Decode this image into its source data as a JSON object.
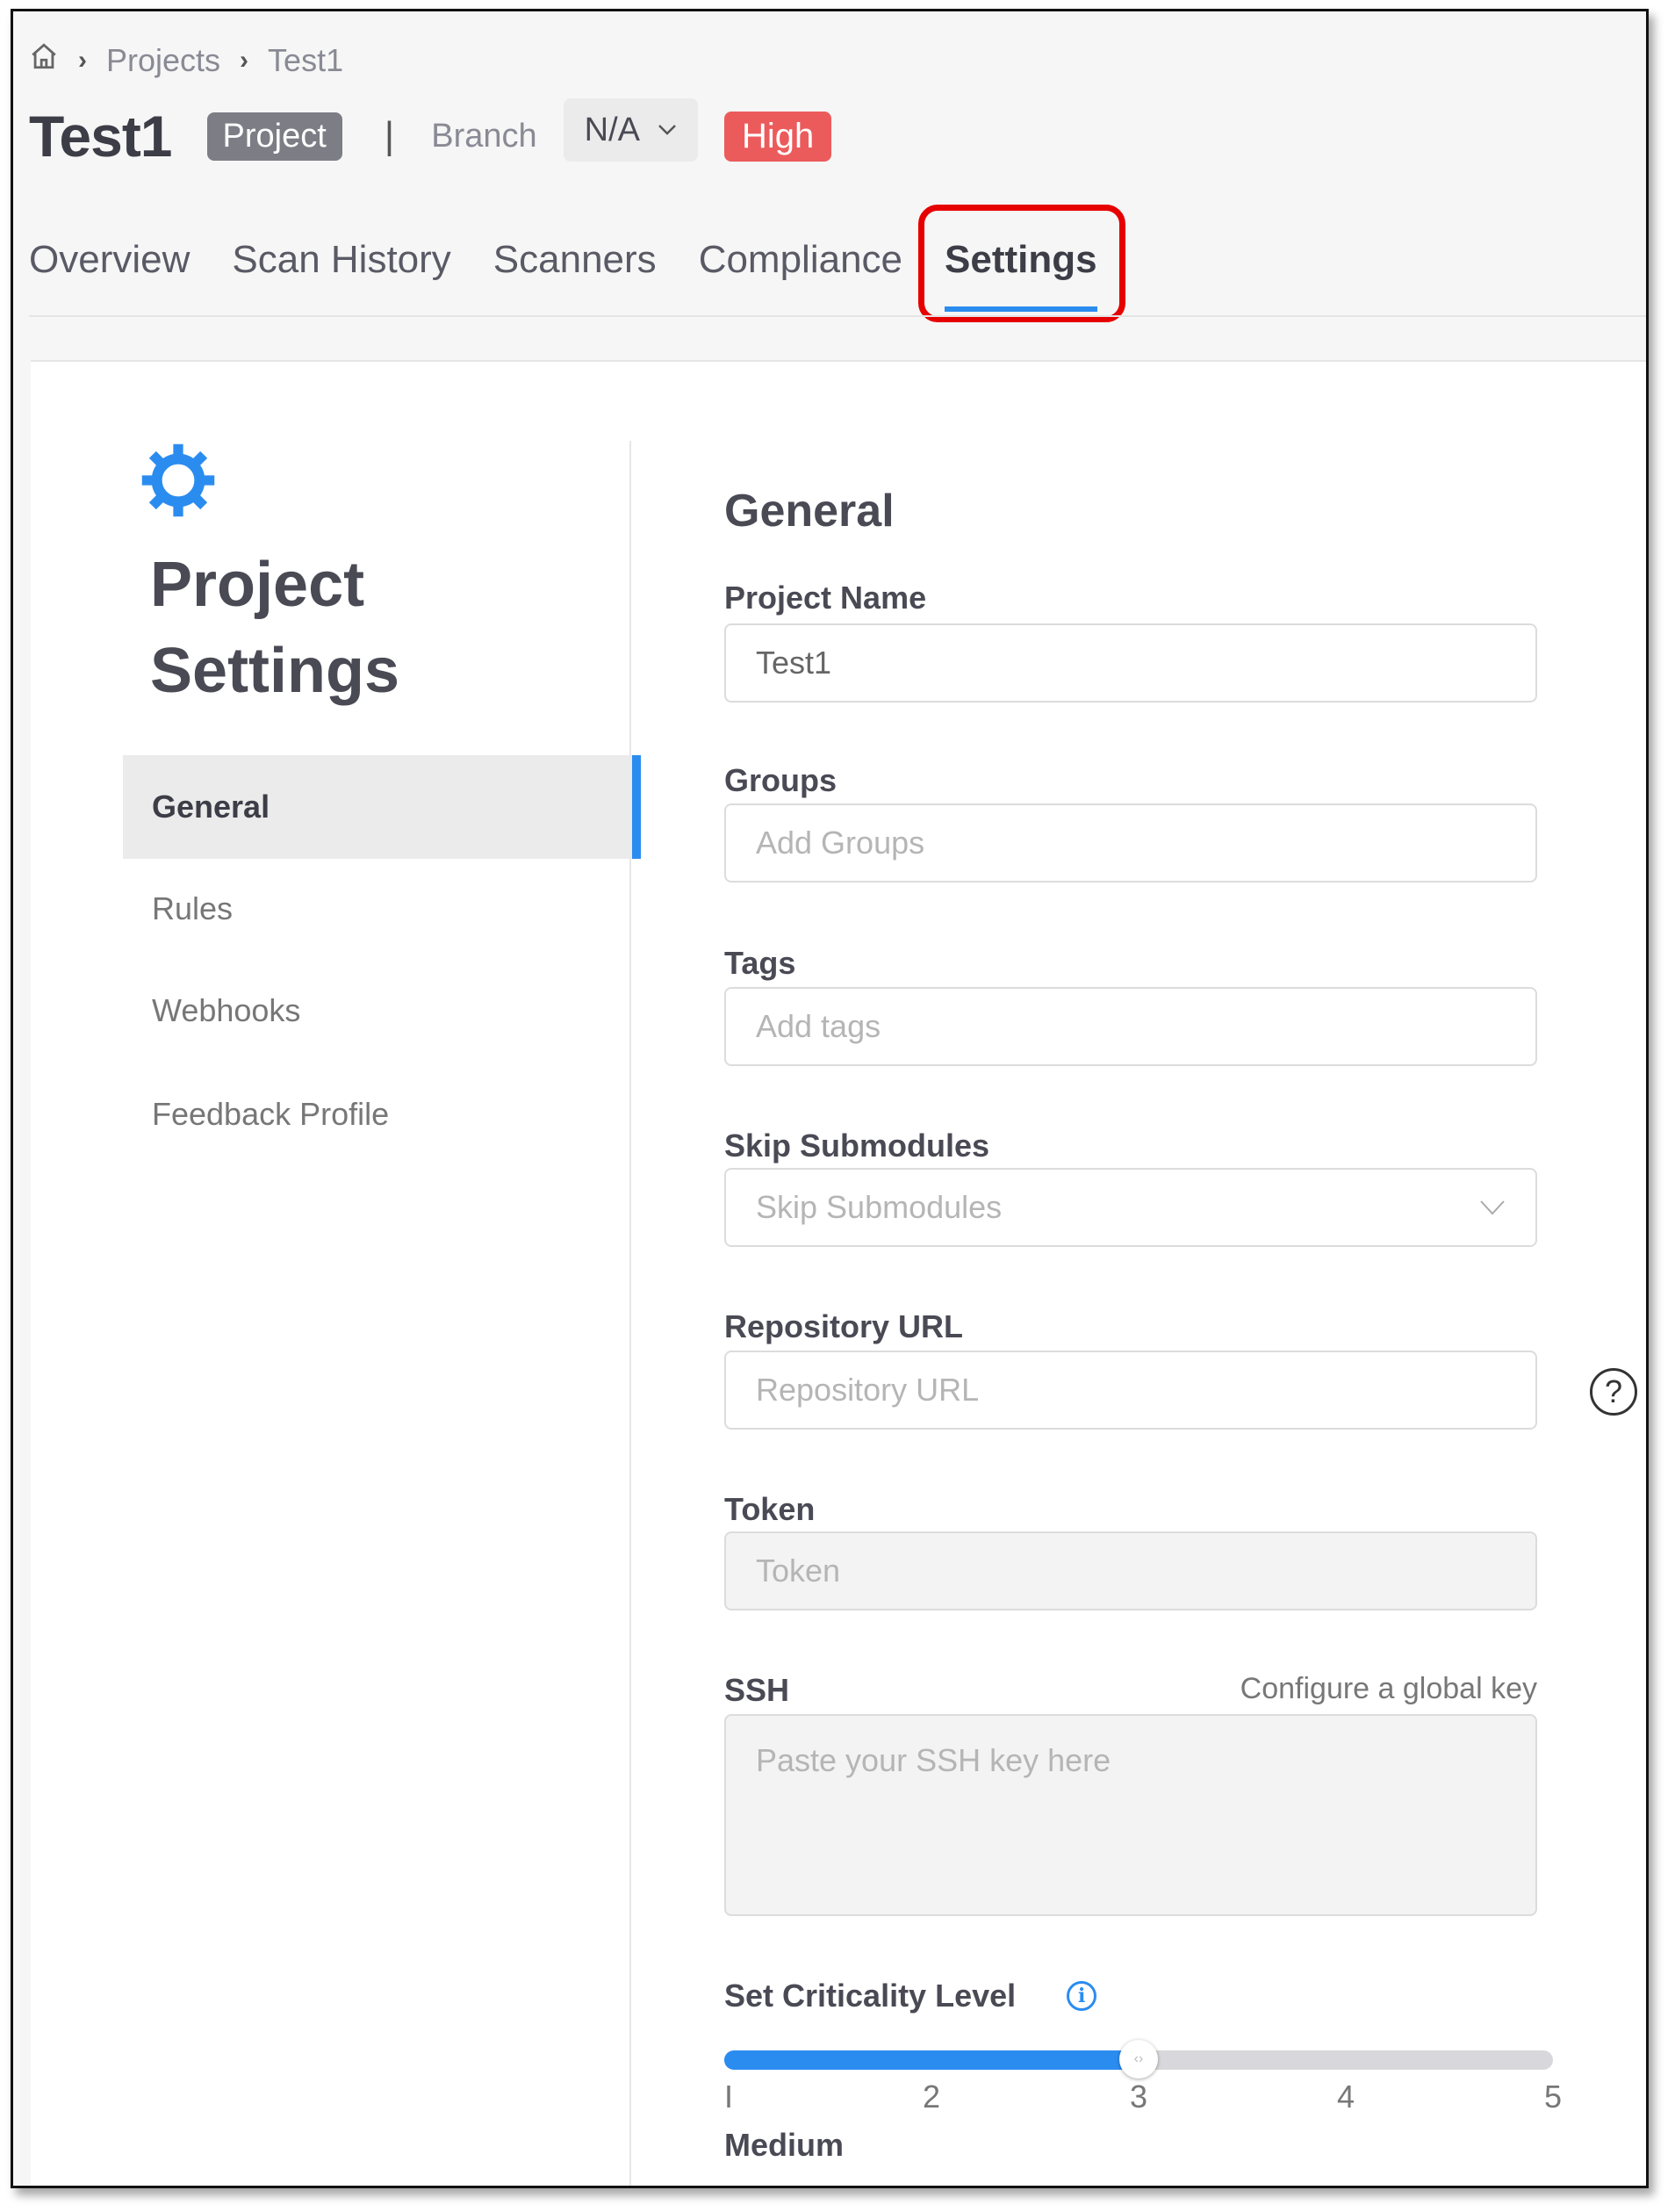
{
  "breadcrumb": {
    "home_icon": "home-icon",
    "items": [
      "Projects",
      "Test1"
    ]
  },
  "header": {
    "title": "Test1",
    "type_badge": "Project",
    "separator": "|",
    "branch_label": "Branch",
    "branch_value": "N/A",
    "severity_badge": "High",
    "colors": {
      "severity": "#ec5b5b",
      "type_badge": "#7d7d86",
      "accent": "#2b8cf0"
    }
  },
  "tabs": [
    {
      "label": "Overview",
      "active": false
    },
    {
      "label": "Scan History",
      "active": false
    },
    {
      "label": "Scanners",
      "active": false
    },
    {
      "label": "Compliance",
      "active": false
    },
    {
      "label": "Settings",
      "active": true
    }
  ],
  "sidebar": {
    "icon": "gear-icon",
    "title_line1": "Project",
    "title_line2": "Settings",
    "items": [
      {
        "label": "General",
        "active": true
      },
      {
        "label": "Rules",
        "active": false
      },
      {
        "label": "Webhooks",
        "active": false
      },
      {
        "label": "Feedback Profile",
        "active": false
      }
    ]
  },
  "form": {
    "section_title": "General",
    "project_name": {
      "label": "Project Name",
      "value": "Test1"
    },
    "groups": {
      "label": "Groups",
      "placeholder": "Add Groups"
    },
    "tags": {
      "label": "Tags",
      "placeholder": "Add tags"
    },
    "skip_submodules": {
      "label": "Skip Submodules",
      "placeholder": "Skip Submodules"
    },
    "repository_url": {
      "label": "Repository URL",
      "placeholder": "Repository URL",
      "help_icon": "?"
    },
    "token": {
      "label": "Token",
      "placeholder": "Token"
    },
    "ssh": {
      "label": "SSH",
      "link": "Configure a global key",
      "placeholder": "Paste your SSH key here"
    },
    "criticality": {
      "label": "Set Criticality Level",
      "info_icon": "i",
      "min": 1,
      "max": 5,
      "value": 3,
      "ticks": [
        "1",
        "2",
        "3",
        "4",
        "5"
      ],
      "value_label": "Medium",
      "thumb_glyph": "‹›"
    }
  }
}
